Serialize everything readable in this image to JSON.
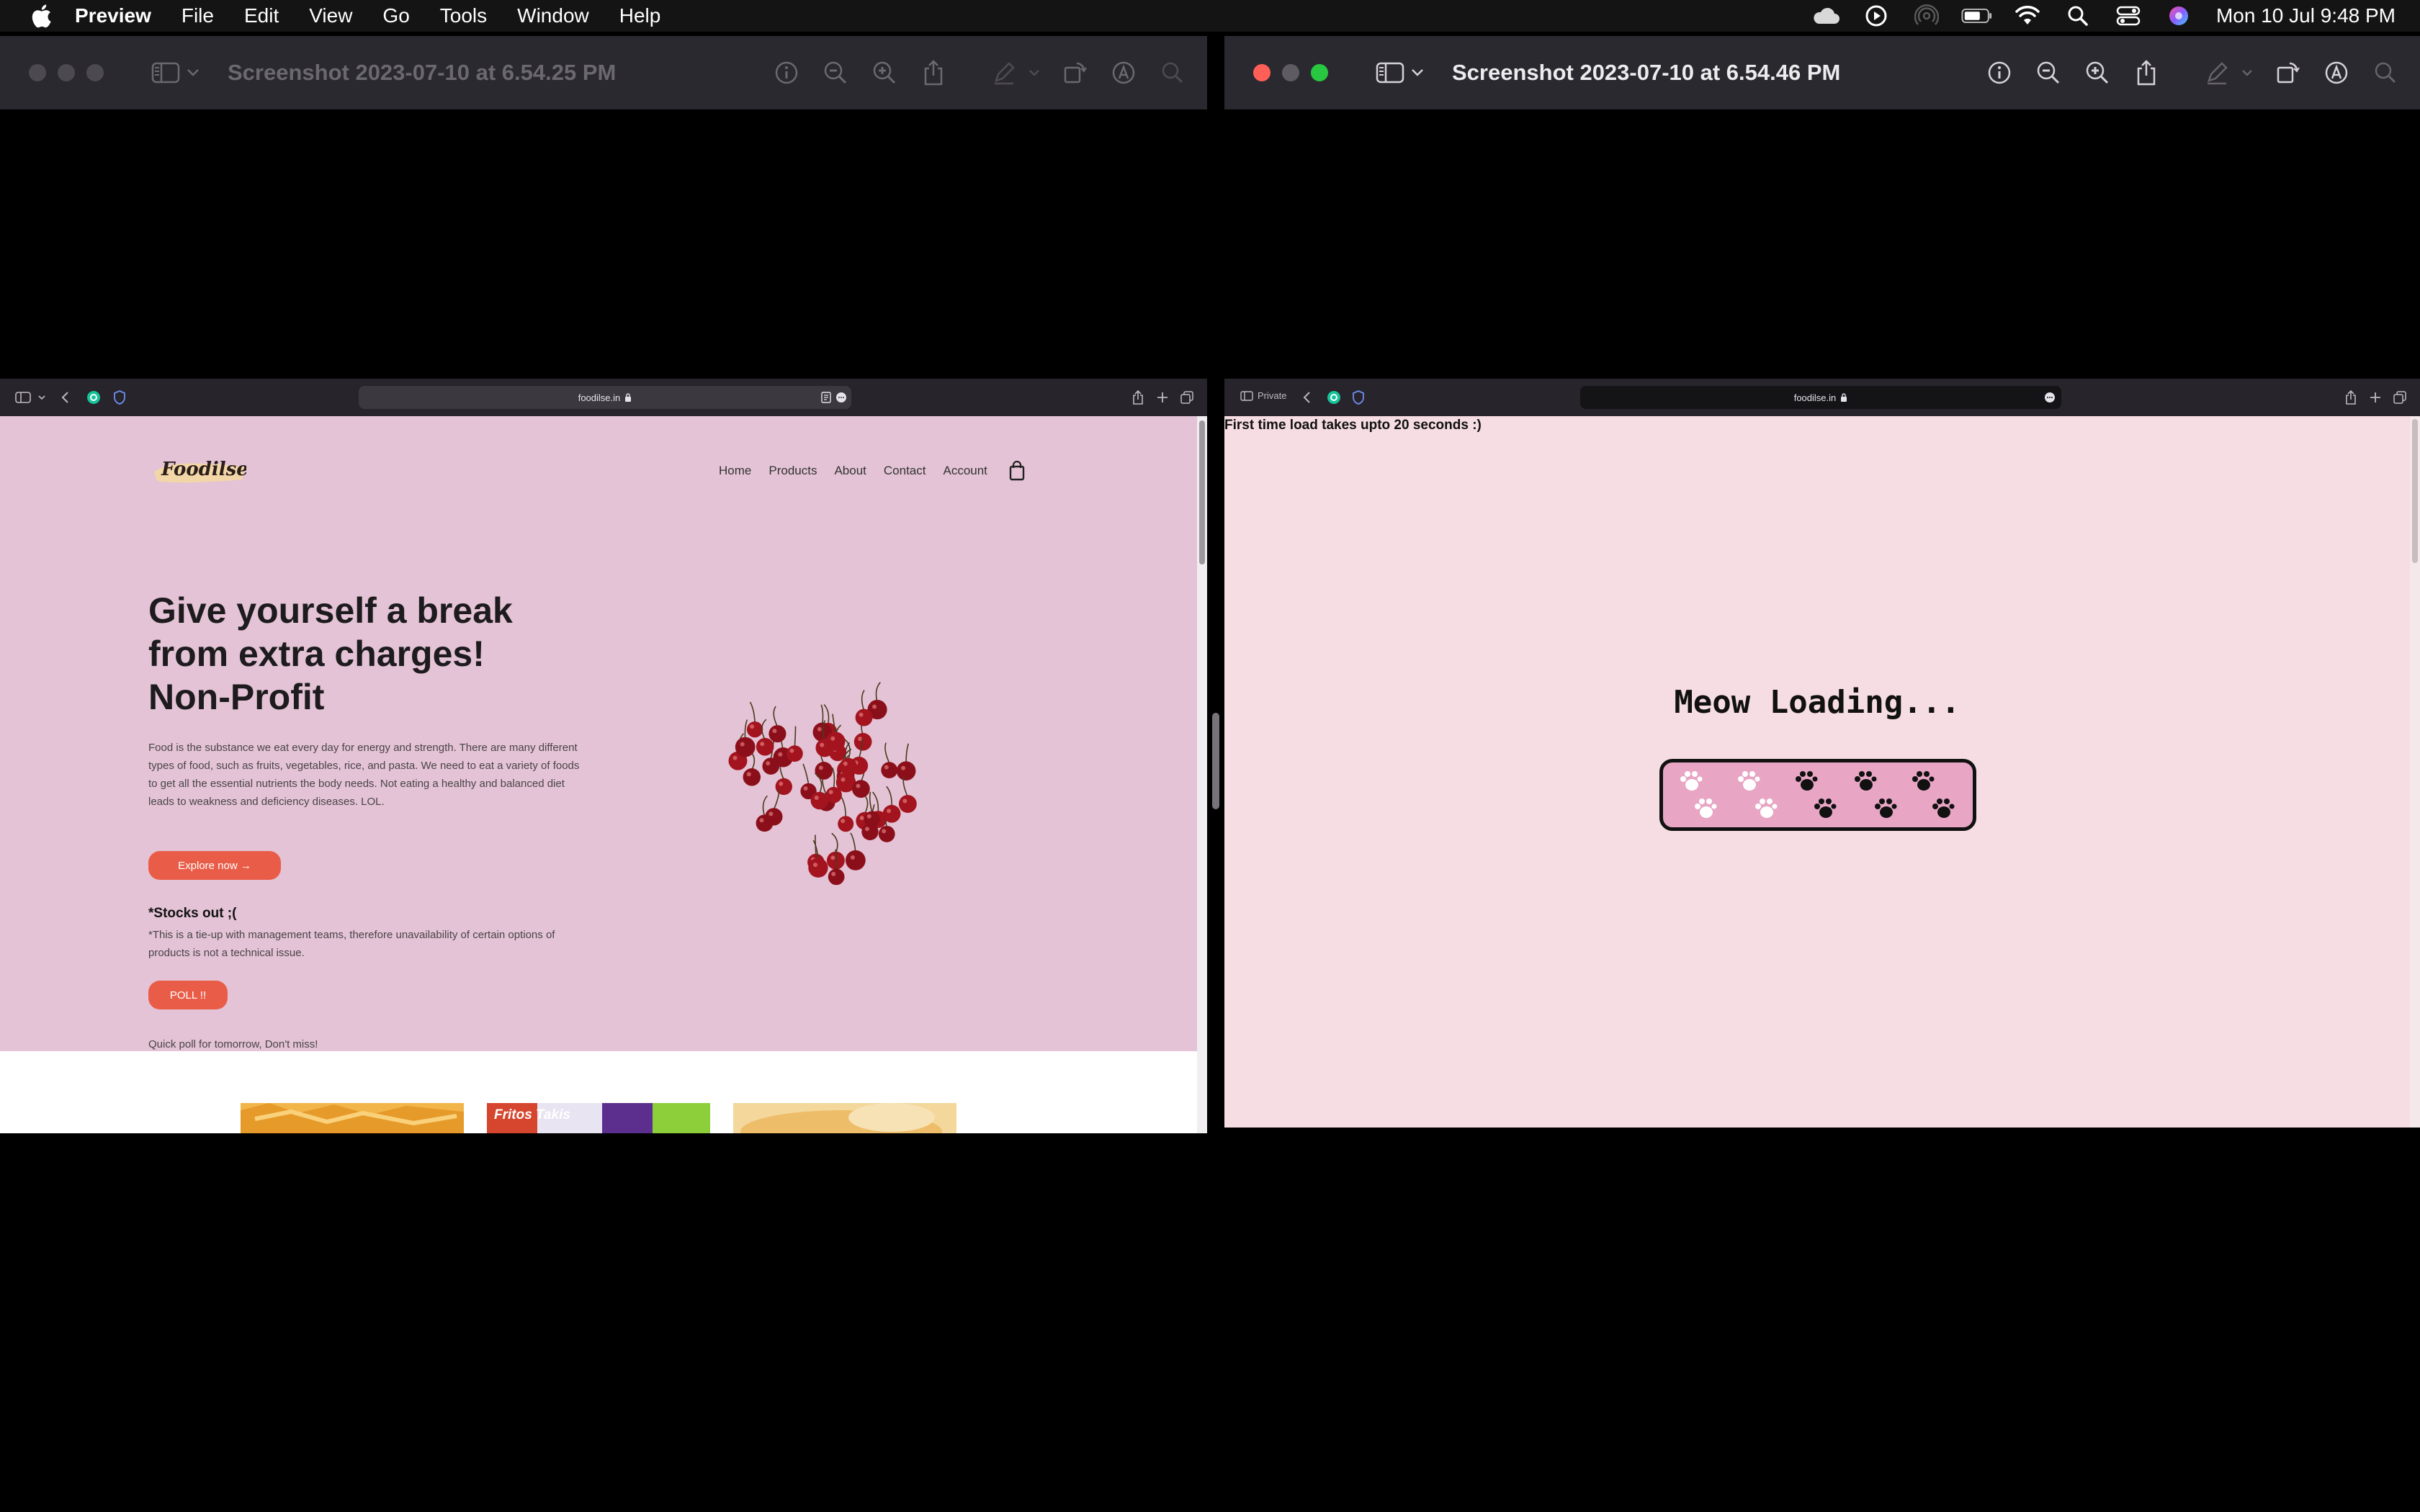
{
  "menubar": {
    "app_name": "Preview",
    "menus": [
      "File",
      "Edit",
      "View",
      "Go",
      "Tools",
      "Window",
      "Help"
    ],
    "clock": "Mon 10 Jul  9:48 PM"
  },
  "left_window": {
    "title": "Screenshot 2023-07-10 at 6.54.25 PM",
    "safari": {
      "url": "foodilse.in"
    },
    "site": {
      "logo_text": "Foodilse",
      "nav": [
        "Home",
        "Products",
        "About",
        "Contact",
        "Account"
      ],
      "headline": [
        "Give yourself a break",
        "from extra charges!",
        "Non-Profit"
      ],
      "description": "Food is the substance we eat every day for energy and strength. There are many different types of food, such as fruits, vegetables, rice, and pasta. We need to eat a variety of foods to get all the essential nutrients the body needs. Not eating a healthy and balanced diet leads to weakness and deficiency diseases. LOL.",
      "explore_label": "Explore now  →",
      "stocks_title": "*Stocks out ;(",
      "stocks_note": "*This is a tie-up with management teams, therefore unavailability of certain options of products is not a technical issue.",
      "poll_label": "POLL !!",
      "poll_note": "Quick poll for tomorrow, Don't miss!",
      "product_tiles": [
        "",
        "Fritos  Takis",
        ""
      ]
    }
  },
  "right_window": {
    "title": "Screenshot 2023-07-10 at 6.54.46 PM",
    "safari": {
      "private_label": "Private",
      "url": "foodilse.in"
    },
    "page": {
      "first_load_note": "First time load takes upto 20 seconds :)",
      "loading_title": "Meow Loading..."
    }
  },
  "colors": {
    "hero_bg": "#e3c3d5",
    "accent_button": "#e95d48",
    "loader_bg": "#e8a5c4",
    "loading_page_bg": "#f6dde3"
  },
  "icons": {
    "menubar_right": [
      "icloud-icon",
      "play-circle-icon",
      "airdrop-icon",
      "battery-icon",
      "wifi-icon",
      "search-icon",
      "control-center-icon",
      "siri-icon"
    ],
    "preview_toolbar": [
      "info-icon",
      "zoom-out-icon",
      "zoom-in-icon",
      "share-icon",
      "markup-pen-icon",
      "chevron-down-icon",
      "rotate-icon",
      "annotate-icon",
      "search-icon"
    ]
  }
}
